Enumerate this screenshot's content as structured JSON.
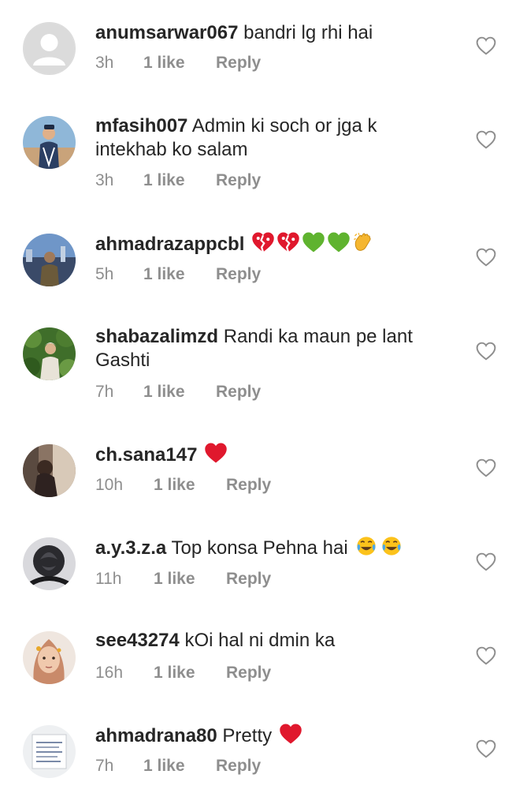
{
  "comments": [
    {
      "username": "anumsarwar067",
      "text_line1": "bandri lg rhi hai",
      "text_line2": "",
      "time": "3h",
      "likes": "1 like",
      "reply": "Reply",
      "emojis": []
    },
    {
      "username": "mfasih007",
      "text_line1": "Admin ki soch or jga k",
      "text_line2": "intekhab ko salam",
      "time": "3h",
      "likes": "1 like",
      "reply": "Reply",
      "emojis": []
    },
    {
      "username": "ahmadrazappcbl",
      "text_line1": "",
      "text_line2": "",
      "time": "5h",
      "likes": "1 like",
      "reply": "Reply",
      "emojis": [
        "broken-heart-emoji",
        "broken-heart-emoji",
        "green-heart-emoji",
        "green-heart-emoji",
        "clapping-hands-emoji"
      ]
    },
    {
      "username": "shabazalimzd",
      "text_line1": "Randi ka maun pe lant",
      "text_line2": "Gashti",
      "time": "7h",
      "likes": "1 like",
      "reply": "Reply",
      "emojis": []
    },
    {
      "username": "ch.sana147",
      "text_line1": "",
      "text_line2": "",
      "time": "10h",
      "likes": "1 like",
      "reply": "Reply",
      "emojis": [
        "red-heart-emoji"
      ]
    },
    {
      "username": "a.y.3.z.a",
      "text_line1": "Top konsa Pehna hai",
      "text_line2": "",
      "time": "11h",
      "likes": "1 like",
      "reply": "Reply",
      "emojis": [
        "tears-of-joy-emoji",
        "tears-of-joy-emoji"
      ]
    },
    {
      "username": "see43274",
      "text_line1": "kOi hal ni dmin ka",
      "text_line2": "",
      "time": "16h",
      "likes": "1 like",
      "reply": "Reply",
      "emojis": []
    },
    {
      "username": "ahmadrana80",
      "text_line1": "Pretty",
      "text_line2": "",
      "time": "7h",
      "likes": "1 like",
      "reply": "Reply",
      "emojis": [
        "red-heart-emoji"
      ]
    }
  ],
  "avatar_text": {
    "ahmadrana80": "Easy is to judge the mistakes of others. Difficult is to realize your own mistakes."
  },
  "colors": {
    "text": "#262626",
    "secondary": "#8e8e8e",
    "red_heart": "#e0182d",
    "green_heart": "#5fb32f"
  }
}
